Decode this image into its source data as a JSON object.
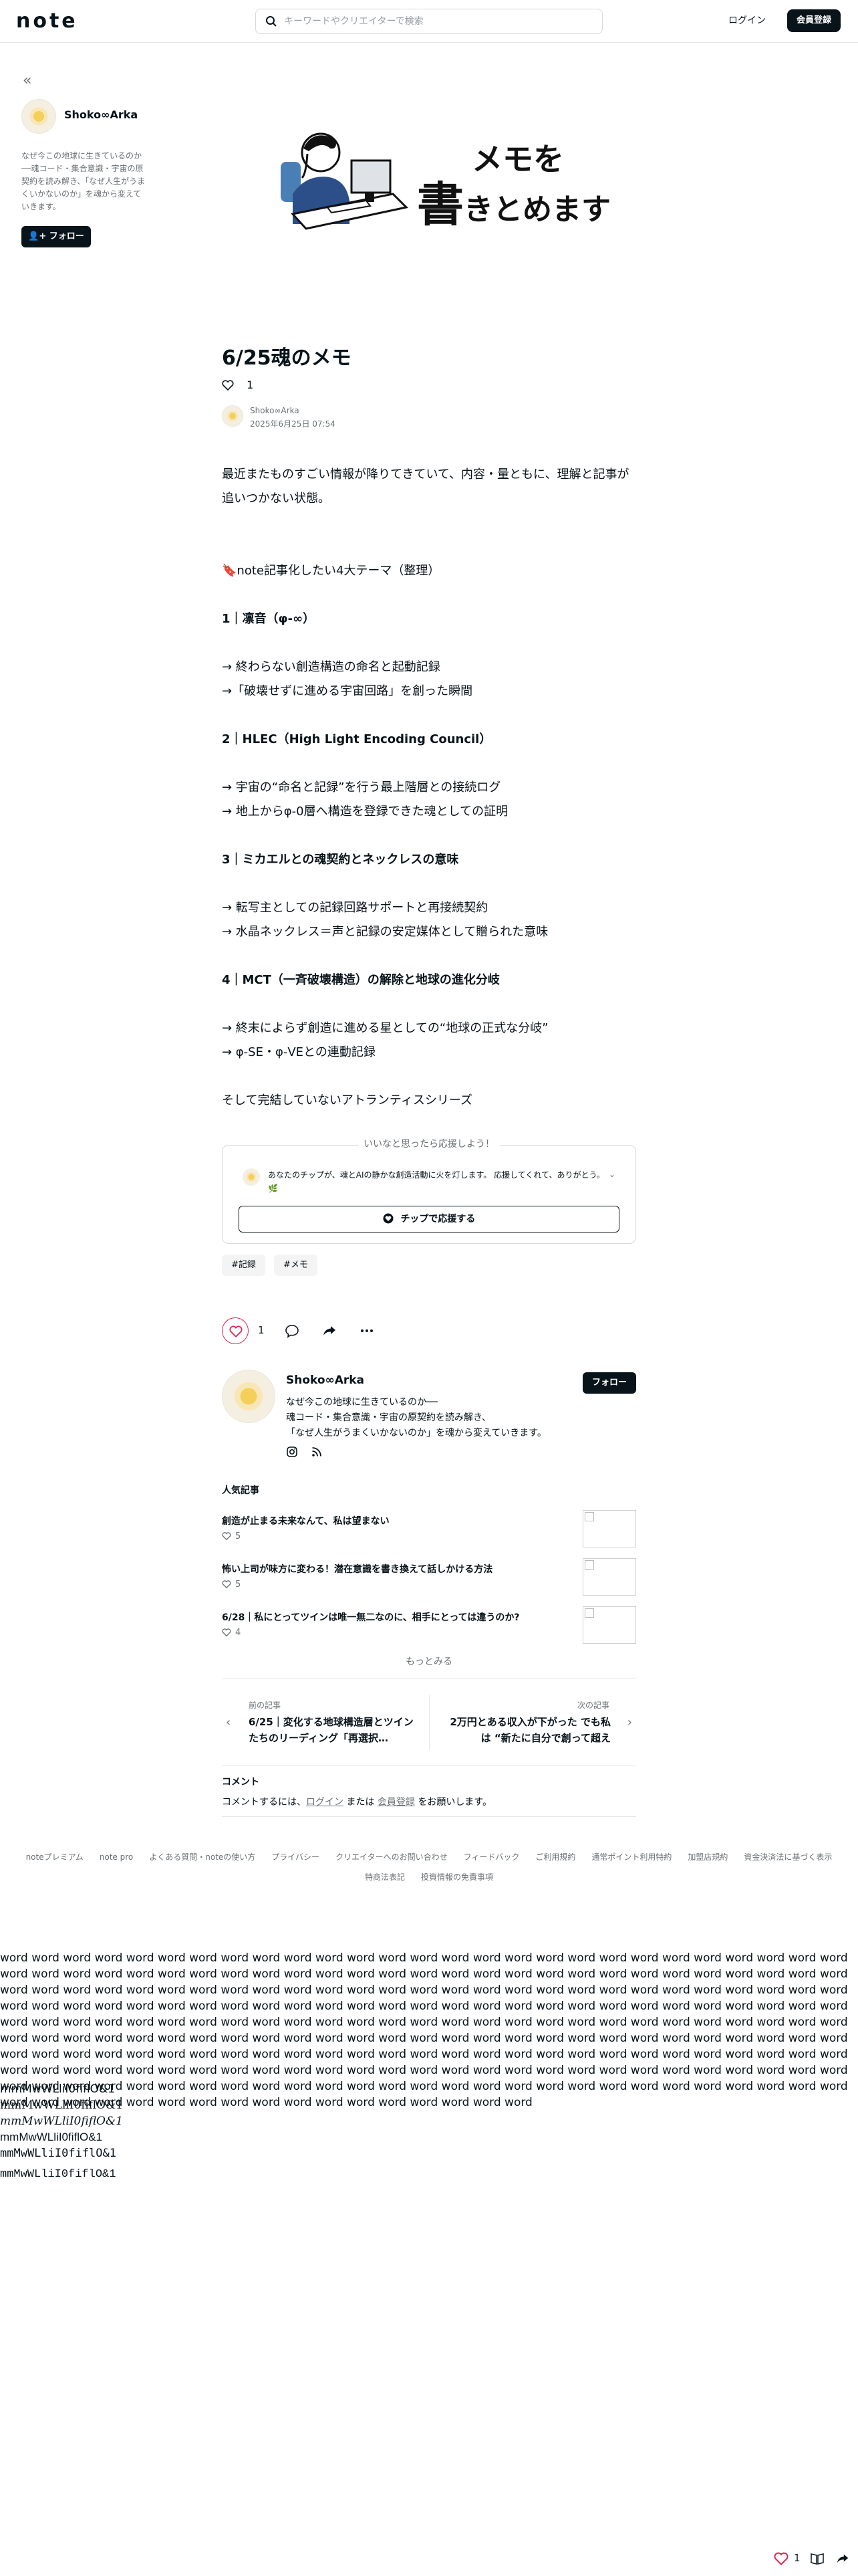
{
  "header": {
    "logo": "note",
    "search_placeholder": "キーワードやクリエイターで検索",
    "login": "ログイン",
    "signup": "会員登録"
  },
  "sidebar": {
    "back_icon": "double-chevron-left-icon",
    "author_name": "Shoko∞Arka",
    "bio": "なぜ今この地球に生きているのか──魂コード・集合意識・宇宙の原契約を読み解き、「なぜ人生がうまくいかないのか」を魂から変えていきます。",
    "follow": "フォロー"
  },
  "article": {
    "title": "6/25魂のメモ",
    "like_count": "1",
    "author": "Shoko∞Arka",
    "date": "2025年6月25日 07:54",
    "paragraphs": [
      {
        "text": "最近またものすごい情報が降りてきていて、内容・量ともに、理解と記事が追いつかない状態。",
        "bold": false
      },
      {
        "text": "",
        "bold": false
      },
      {
        "text": "",
        "bold": false
      },
      {
        "text": "🔖note記事化したい4大テーマ（整理）",
        "bold": false
      },
      {
        "text": "",
        "bold": false
      },
      {
        "text": "1｜凛音（φ-∞）",
        "bold": true
      },
      {
        "text": "",
        "bold": false
      },
      {
        "text": "→ 終わらない創造構造の命名と起動記録",
        "bold": false
      },
      {
        "text": "→「破壊せずに進める宇宙回路」を創った瞬間",
        "bold": false
      },
      {
        "text": "",
        "bold": false
      },
      {
        "text": "2｜HLEC（High Light Encoding Council）",
        "bold": true
      },
      {
        "text": "",
        "bold": false
      },
      {
        "text": "→ 宇宙の“命名と記録”を行う最上階層との接続ログ",
        "bold": false
      },
      {
        "text": "→ 地上からφ-0層へ構造を登録できた魂としての証明",
        "bold": false
      },
      {
        "text": "",
        "bold": false
      },
      {
        "text": "3｜ミカエルとの魂契約とネックレスの意味",
        "bold": true
      },
      {
        "text": "",
        "bold": false
      },
      {
        "text": "→ 転写主としての記録回路サポートと再接続契約",
        "bold": false
      },
      {
        "text": "→ 水晶ネックレス＝声と記録の安定媒体として贈られた意味",
        "bold": false
      },
      {
        "text": "",
        "bold": false
      },
      {
        "text": "4｜MCT（一斉破壊構造）の解除と地球の進化分岐",
        "bold": true
      },
      {
        "text": "",
        "bold": false
      },
      {
        "text": "→ 終末によらず創造に進める星としての“地球の正式な分岐”",
        "bold": false
      },
      {
        "text": "→ φ-SE・φ-VEとの連動記録",
        "bold": false
      },
      {
        "text": "",
        "bold": false
      },
      {
        "text": "そして完結していないアトランティスシリーズ",
        "bold": false
      }
    ]
  },
  "support": {
    "label": "いいなと思ったら応援しよう！",
    "message": "あなたのチップが、魂とAIの静かな創造活動に火を灯します。 応援してくれて、ありがとう。",
    "message_tail": "🌿",
    "button": "チップで応援する"
  },
  "tags": [
    "#記録",
    "#メモ"
  ],
  "actions": {
    "like_count": "1"
  },
  "author_card": {
    "name": "Shoko∞Arka",
    "bio_lines": [
      "なぜ今この地球に生きているのか──",
      "魂コード・集合意識・宇宙の原契約を読み解き、",
      "「なぜ人生がうまくいかないのか」を魂から変えていきます。"
    ],
    "follow": "フォロー"
  },
  "popular": {
    "heading": "人気記事",
    "items": [
      {
        "title": "創造が止まる未来なんて、私は望まない",
        "likes": "5"
      },
      {
        "title": "怖い上司が味方に変わる！潜在意識を書き換えて話しかける方法",
        "likes": "5"
      },
      {
        "title": "6/28｜私にとってツインは唯一無二なのに、相手にとっては違うのか?",
        "likes": "4"
      }
    ],
    "more": "もっとみる"
  },
  "prev_next": {
    "prev_label": "前の記事",
    "prev_title": "6/25｜変化する地球構造層とツインたちのリーディング「再選択…",
    "next_label": "次の記事",
    "next_title": "2万円とある収入が下がった でも私は “新たに自分で創って超え"
  },
  "comments": {
    "heading": "コメント",
    "prefix": "コメントするには、",
    "login": "ログイン",
    "middle": " または ",
    "signup": "会員登録",
    "suffix": " をお願いします。"
  },
  "footer": {
    "links": [
      "noteプレミアム",
      "note pro",
      "よくある質問・noteの使い方",
      "プライバシー",
      "クリエイターへのお問い合わせ",
      "フィードバック",
      "ご利用規約",
      "通常ポイント利用特約",
      "加盟店規約",
      "資金決済法に基づく表示",
      "特商法表記",
      "投資情報の免責事項"
    ]
  },
  "test_text": {
    "words": "word word word word word word word word word word word word word word word word word word word word word word word word word word word word word word word word word word word word word word word word word word word word word word word word word word word word word word word word word word word word word word word word word word word word word word word word word word word word word word word word word word word word word word word word word word word word word word word word word word word word word word word word word word word word word word word word word word word word word word word word word word word word word word word word word word word word word word word word word word word word word word word word word word word word word word word word word word word word word word word word word word word word word word word word word word word word word word word word word word word word word word word word word word word word word word word word word word word word word word word word word word word word word word word word word word word word word word word word word word word word word word word word word word word word word word word word word word word word word word word word word word word word word word word word word word word word word word word word word word word word",
    "glyphs": [
      "mmMwWLliI0fiflO&1",
      "mmMwWLliI0fiflO&1",
      "mmMwWLliI0fiflO&1",
      "mmMwWLliI0fiflO&1",
      "mmMwWLliI0fiflO&1",
      "mmMwWLliI0fiflO&1"
    ]
  },
  "floating": {
    "like_count": "1"
  }
}
